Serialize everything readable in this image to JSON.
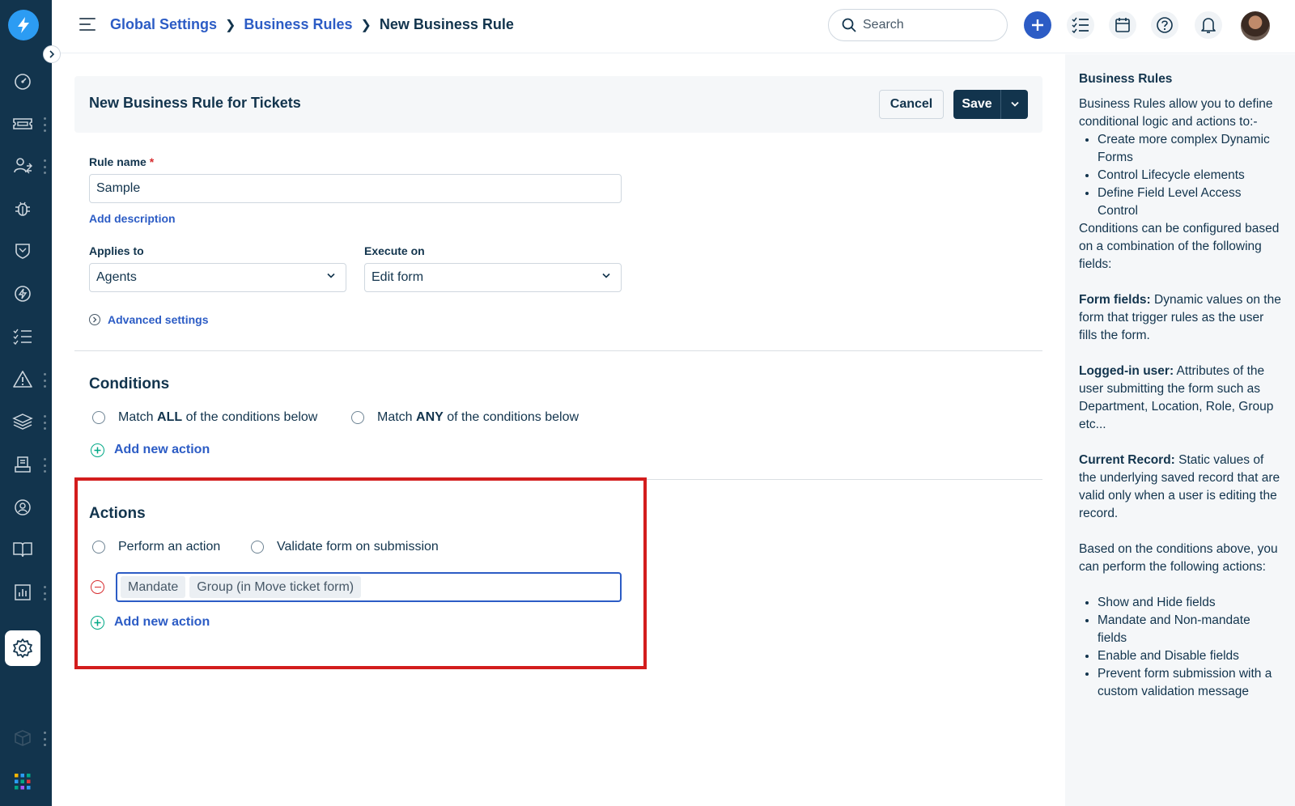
{
  "header": {
    "breadcrumb": [
      "Global Settings",
      "Business Rules",
      "New Business Rule"
    ],
    "search_placeholder": "Search"
  },
  "form": {
    "title": "New Business Rule for Tickets",
    "cancel_label": "Cancel",
    "save_label": "Save",
    "rule_name_label": "Rule name",
    "rule_name_required": "*",
    "rule_name_value": "Sample",
    "add_description": "Add description",
    "applies_to_label": "Applies to",
    "applies_to_value": "Agents",
    "execute_on_label": "Execute on",
    "execute_on_value": "Edit form",
    "advanced_settings": "Advanced settings"
  },
  "conditions": {
    "title": "Conditions",
    "match_all_pre": "Match ",
    "match_all_bold": "ALL",
    "match_all_post": " of the conditions below",
    "match_any_pre": "Match ",
    "match_any_bold": "ANY",
    "match_any_post": " of the conditions below",
    "add_new_action": "Add new action"
  },
  "actions": {
    "title": "Actions",
    "perform_action": "Perform an action",
    "validate_form": "Validate form on submission",
    "tokens": [
      "Mandate",
      "Group (in Move ticket form)"
    ],
    "add_new_action": "Add new action"
  },
  "help": {
    "title": "Business Rules",
    "intro": "Business Rules allow you to define conditional logic and actions to:-",
    "intro_list": [
      "Create more complex Dynamic Forms",
      "Control Lifecycle elements",
      "Define Field Level Access Control"
    ],
    "conditions_text": "Conditions can be configured based on a combination of the following fields:",
    "form_fields_label": "Form fields:",
    "form_fields_text": " Dynamic values on the form that trigger rules as the user fills the form.",
    "logged_in_label": "Logged-in user:",
    "logged_in_text": " Attributes of the user submitting the form such as Department, Location, Role, Group etc...",
    "current_record_label": "Current Record:",
    "current_record_text": " Static values of the underlying saved record that are valid only when a user is editing the record.",
    "based_text": "Based on the conditions above, you can perform the following actions:",
    "actions_list": [
      "Show and Hide fields",
      "Mandate and Non-mandate fields",
      "Enable and Disable fields",
      "Prevent form submission with a custom validation message"
    ]
  },
  "colors": {
    "nav_bg": "#12344d",
    "link_blue": "#2c5cc5",
    "highlight_red": "#d31d1d",
    "add_green": "#00a886"
  },
  "icons": {
    "nav": [
      "dashboard-icon",
      "tickets-icon",
      "contacts-icon",
      "problems-icon",
      "changes-icon",
      "releases-icon",
      "tasks-icon",
      "alerts-icon",
      "assets-icon",
      "inventory-icon",
      "solutions-icon",
      "knowledge-icon",
      "reports-icon",
      "settings-icon",
      "cube-icon",
      "apps-grid-icon"
    ]
  }
}
